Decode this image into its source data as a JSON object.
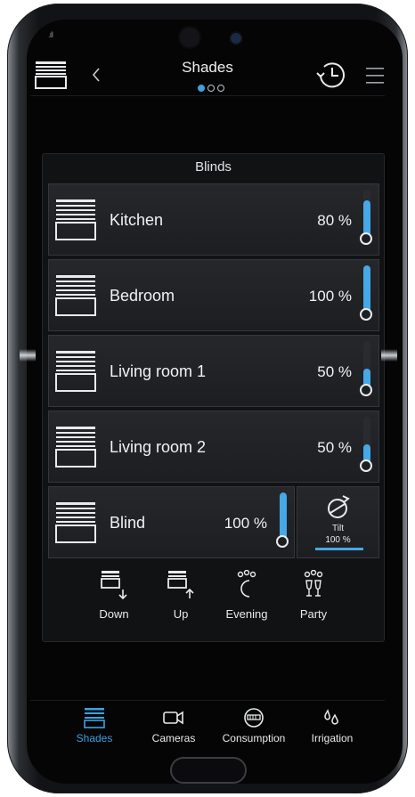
{
  "header": {
    "title": "Shades",
    "page_index": 1,
    "page_count": 3
  },
  "panel": {
    "title": "Blinds"
  },
  "rows": [
    {
      "label": "Kitchen",
      "percent_text": "80 %",
      "level": 0.8
    },
    {
      "label": "Bedroom",
      "percent_text": "100 %",
      "level": 1.0
    },
    {
      "label": "Living room 1",
      "percent_text": "50 %",
      "level": 0.5
    },
    {
      "label": "Living room 2",
      "percent_text": "50 %",
      "level": 0.5
    },
    {
      "label": "Blind",
      "percent_text": "100 %",
      "level": 1.0
    }
  ],
  "tilt": {
    "label": "Tilt",
    "value_text": "100 %",
    "level": 1.0
  },
  "actions": [
    {
      "label": "Down",
      "icon": "blind-down-icon"
    },
    {
      "label": "Up",
      "icon": "blind-up-icon"
    },
    {
      "label": "Evening",
      "icon": "evening-icon"
    },
    {
      "label": "Party",
      "icon": "party-icon"
    }
  ],
  "tabs": [
    {
      "label": "Shades",
      "icon": "shades-icon",
      "active": true
    },
    {
      "label": "Cameras",
      "icon": "camera-icon",
      "active": false
    },
    {
      "label": "Consumption",
      "icon": "meter-icon",
      "active": false
    },
    {
      "label": "Irrigation",
      "icon": "water-drops-icon",
      "active": false
    }
  ],
  "colors": {
    "accent": "#3ea1e0",
    "background": "#050506",
    "row": "#222327",
    "text": "#f0f2f4"
  }
}
